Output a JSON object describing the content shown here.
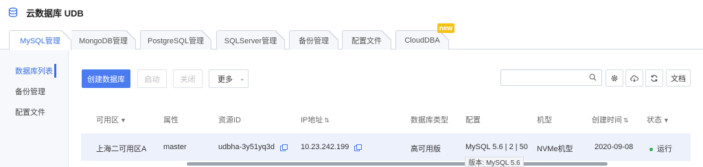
{
  "app": {
    "title": "云数据库 UDB",
    "icon": "database-icon"
  },
  "tabs": [
    {
      "label": "MySQL管理",
      "active": true
    },
    {
      "label": "MongoDB管理",
      "active": false
    },
    {
      "label": "PostgreSQL管理",
      "active": false
    },
    {
      "label": "SQLServer管理",
      "active": false
    },
    {
      "label": "备份管理",
      "active": false
    },
    {
      "label": "配置文件",
      "active": false
    },
    {
      "label": "CloudDBA",
      "active": false,
      "badge": "new"
    }
  ],
  "sidebar": {
    "items": [
      {
        "label": "数据库列表",
        "active": true
      },
      {
        "label": "备份管理",
        "active": false
      },
      {
        "label": "配置文件",
        "active": false
      }
    ]
  },
  "toolbar": {
    "create_label": "创建数据库",
    "start_label": "启动",
    "stop_label": "关闭",
    "more_label": "更多",
    "search_placeholder": "",
    "export_label": "文档"
  },
  "table": {
    "columns": [
      "可用区",
      "属性",
      "资源ID",
      "IP地址",
      "数据库类型",
      "配置",
      "机型",
      "创建时间",
      "状态"
    ],
    "rows": [
      {
        "zone": "上海二可用区A",
        "attribute": "master",
        "resource_id": "udbha-3y51yq3d",
        "ip": "10.23.242.199",
        "db_type": "高可用版",
        "config": "MySQL 5.6 | 2 | 50",
        "machine": "NVMe机型",
        "created": "2020-09-08",
        "status": "运行"
      }
    ]
  },
  "tooltip": {
    "text": "版本: MySQL 5.6"
  },
  "colors": {
    "accent": "#4a7cf0",
    "status_running": "#2db24a",
    "badge": "#f5c316"
  }
}
